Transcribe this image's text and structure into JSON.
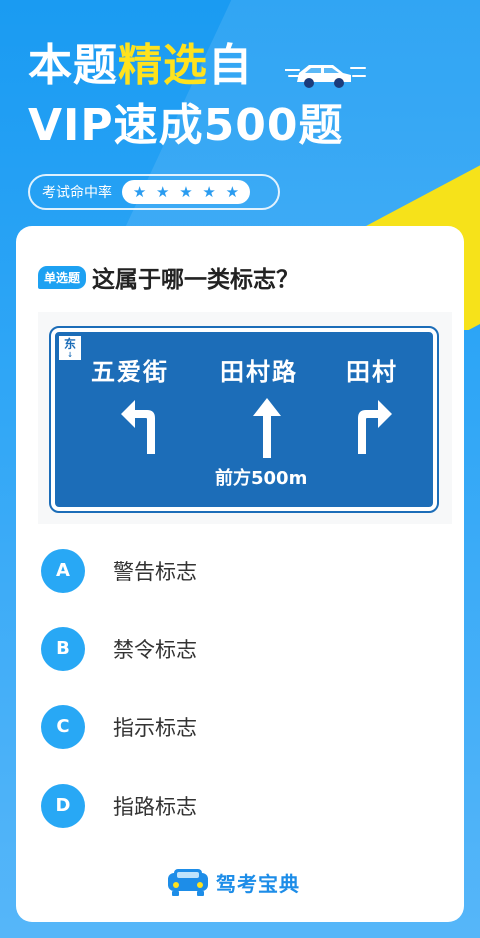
{
  "hero": {
    "line1_prefix": "本题",
    "line1_highlight": "精选",
    "line1_suffix": "自",
    "line2": "VIP速成500题"
  },
  "rating": {
    "label": "考试命中率",
    "stars": [
      "★",
      "★",
      "★",
      "★",
      "★"
    ]
  },
  "question": {
    "tag": "单选题",
    "text": "这属于哪一类标志？"
  },
  "sign": {
    "corner_char": "东",
    "corner_sub": "↓",
    "destinations": [
      "五爱街",
      "田村路",
      "田村"
    ],
    "distance": "前方500m",
    "color": "#1c6db8"
  },
  "options": [
    {
      "letter": "A",
      "text": "警告标志"
    },
    {
      "letter": "B",
      "text": "禁令标志"
    },
    {
      "letter": "C",
      "text": "指示标志"
    },
    {
      "letter": "D",
      "text": "指路标志"
    }
  ],
  "brand": {
    "name": "驾考宝典"
  },
  "colors": {
    "accent": "#28a8f5",
    "highlight": "#ffe21d"
  }
}
